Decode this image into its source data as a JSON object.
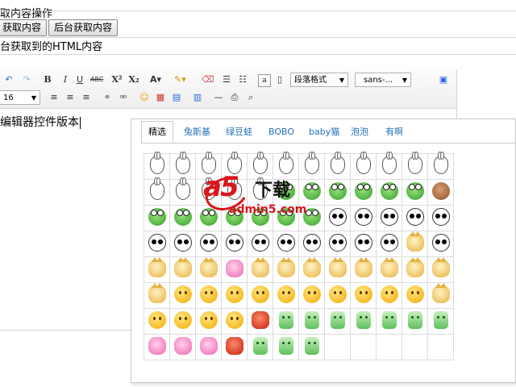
{
  "legend": "取内容操作",
  "buttons": {
    "get_content": "获取内容",
    "bg_get_content": "后台获取内容"
  },
  "subtitle": "台获取到的HTML内容",
  "toolbar": {
    "paragraph_format": "段落格式",
    "font_family": "sans-...",
    "font_size": "16"
  },
  "editor": {
    "content": "编辑器控件版本"
  },
  "emotion_dialog": {
    "tabs": [
      "精选",
      "兔斯基",
      "绿豆蛙",
      "BOBO",
      "baby猫",
      "泡泡",
      "有啊"
    ],
    "active_tab": 0,
    "rows": [
      [
        "rabbit",
        "rabbit",
        "rabbit",
        "rabbit",
        "rabbit",
        "rabbit",
        "rabbit",
        "rabbit",
        "rabbit",
        "rabbit",
        "rabbit",
        "rabbit"
      ],
      [
        "rabbit",
        "rabbit",
        "rabbit",
        "rabbit",
        "rabbit",
        "frog",
        "frog",
        "frog",
        "frog",
        "frog",
        "frog",
        "bear"
      ],
      [
        "frog",
        "frog",
        "frog",
        "frog",
        "frog",
        "frog",
        "frog",
        "panda",
        "panda",
        "panda",
        "panda",
        "panda"
      ],
      [
        "panda",
        "panda",
        "panda",
        "panda",
        "panda",
        "panda",
        "panda",
        "panda",
        "panda",
        "panda",
        "cat",
        "panda"
      ],
      [
        "cat",
        "cat",
        "cat",
        "pink",
        "cat",
        "cat",
        "cat",
        "cat",
        "cat",
        "cat",
        "cat",
        "cat"
      ],
      [
        "cat",
        "face",
        "face",
        "face",
        "face",
        "face",
        "face",
        "face",
        "face",
        "face",
        "face",
        "cat"
      ],
      [
        "face",
        "face",
        "face",
        "face",
        "red",
        "bubble",
        "bubble",
        "bubble",
        "bubble",
        "bubble",
        "bubble",
        "bubble"
      ],
      [
        "pink",
        "pink",
        "pink",
        "red",
        "bubble",
        "bubble",
        "bubble",
        "blank",
        "blank",
        "blank",
        "blank",
        "blank"
      ]
    ]
  },
  "watermark": {
    "logo": "a5",
    "text": "下载",
    "url": "admin5.com"
  }
}
